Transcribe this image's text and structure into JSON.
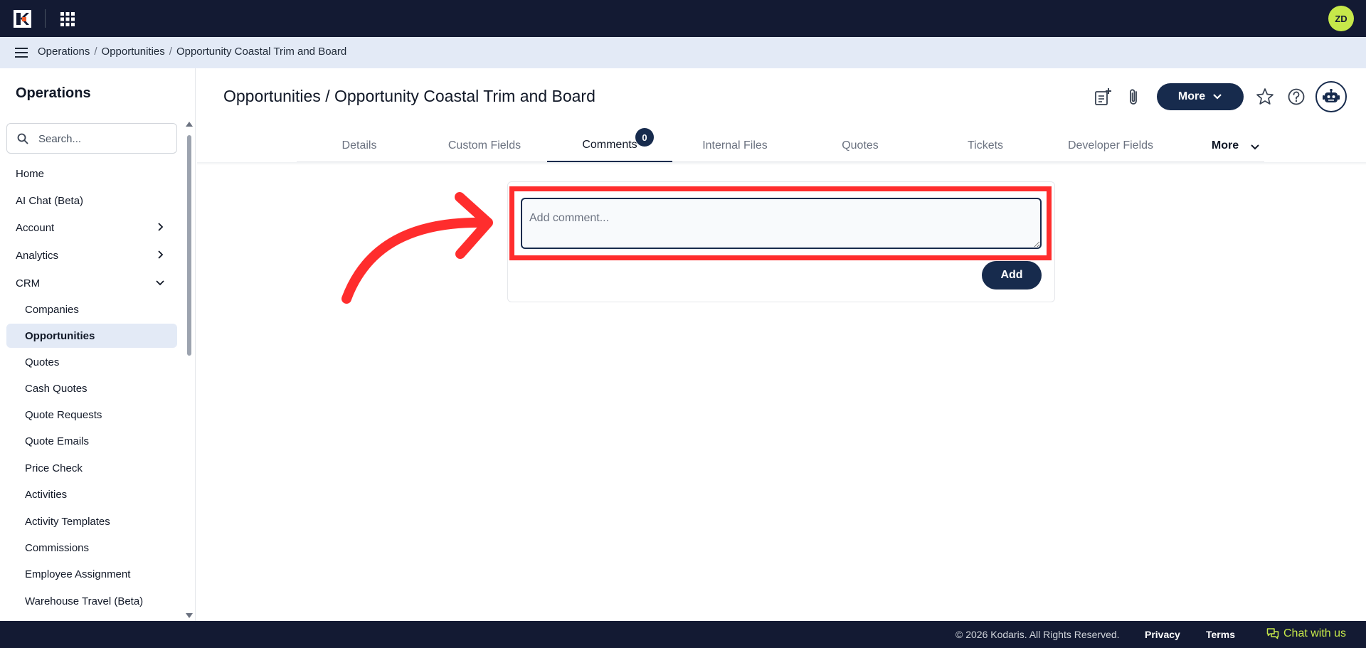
{
  "user": {
    "initials": "ZD"
  },
  "breadcrumb": [
    "Operations",
    "Opportunities",
    "Opportunity Coastal Trim and Board"
  ],
  "sidebar": {
    "title": "Operations",
    "search_placeholder": "Search...",
    "items": [
      {
        "label": "Home"
      },
      {
        "label": "AI Chat (Beta)"
      },
      {
        "label": "Account"
      },
      {
        "label": "Analytics"
      },
      {
        "label": "CRM"
      }
    ],
    "crm_items": [
      {
        "label": "Companies"
      },
      {
        "label": "Opportunities"
      },
      {
        "label": "Quotes"
      },
      {
        "label": "Cash Quotes"
      },
      {
        "label": "Quote Requests"
      },
      {
        "label": "Quote Emails"
      },
      {
        "label": "Price Check"
      },
      {
        "label": "Activities"
      },
      {
        "label": "Activity Templates"
      },
      {
        "label": "Commissions"
      },
      {
        "label": "Employee Assignment"
      },
      {
        "label": "Warehouse Travel (Beta)"
      }
    ]
  },
  "header": {
    "title": "Opportunities / Opportunity Coastal Trim and Board",
    "more_label": "More"
  },
  "tabs": [
    {
      "label": "Details"
    },
    {
      "label": "Custom Fields"
    },
    {
      "label": "Comments",
      "badge": "0"
    },
    {
      "label": "Internal Files"
    },
    {
      "label": "Quotes"
    },
    {
      "label": "Tickets"
    },
    {
      "label": "Developer Fields"
    },
    {
      "label": "More"
    }
  ],
  "comments": {
    "placeholder": "Add comment...",
    "add_label": "Add"
  },
  "footer": {
    "copyright": "© 2026 Kodaris. All Rights Reserved.",
    "privacy": "Privacy",
    "terms": "Terms",
    "chat": "Chat with us"
  },
  "colors": {
    "topbar": "#131a33",
    "primary": "#172b4d",
    "accent": "#c6e84a",
    "annotation": "#ff2d2d",
    "breadcrumb_bg": "#e3eaf6"
  }
}
